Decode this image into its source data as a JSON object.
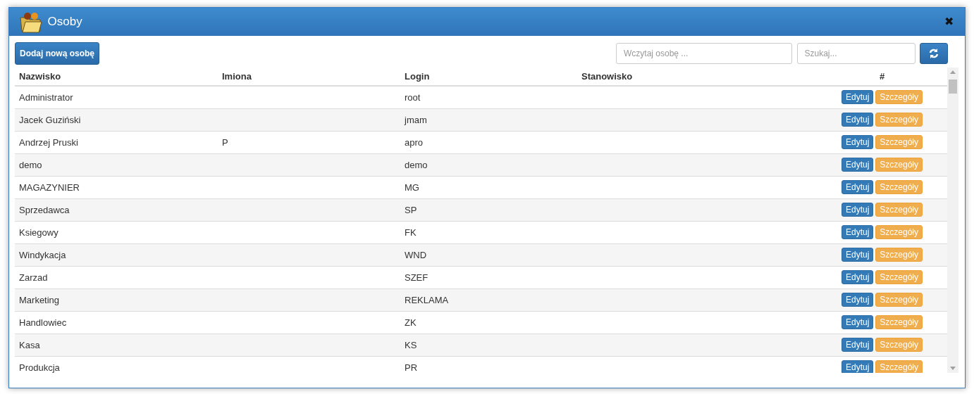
{
  "window": {
    "title": "Osoby",
    "close": "✖"
  },
  "toolbar": {
    "add_button": "Dodaj nową osobę",
    "load_field": {
      "placeholder": "Wczytaj osobę ..."
    },
    "search_field": {
      "placeholder": "Szukaj..."
    }
  },
  "table": {
    "columns": [
      "Nazwisko",
      "Imiona",
      "Login",
      "Stanowisko",
      "#"
    ],
    "rows": [
      {
        "nazwisko": "Administrator",
        "imiona": "",
        "login": "root",
        "stanowisko": "",
        "edit": "Edytuj",
        "details": "Szczegóły"
      },
      {
        "nazwisko": "Jacek Guziński",
        "imiona": "",
        "login": "jmam",
        "stanowisko": "",
        "edit": "Edytuj",
        "details": "Szczegóły"
      },
      {
        "nazwisko": "Andrzej Pruski",
        "imiona": "P",
        "login": "apro",
        "stanowisko": "",
        "edit": "Edytuj",
        "details": "Szczegóły"
      },
      {
        "nazwisko": "demo",
        "imiona": "",
        "login": "demo",
        "stanowisko": "",
        "edit": "Edytuj",
        "details": "Szczegóły"
      },
      {
        "nazwisko": "MAGAZYNIER",
        "imiona": "",
        "login": "MG",
        "stanowisko": "",
        "edit": "Edytuj",
        "details": "Szczegóły"
      },
      {
        "nazwisko": "Sprzedawca",
        "imiona": "",
        "login": "SP",
        "stanowisko": "",
        "edit": "Edytuj",
        "details": "Szczegóły"
      },
      {
        "nazwisko": "Ksiegowy",
        "imiona": "",
        "login": "FK",
        "stanowisko": "",
        "edit": "Edytuj",
        "details": "Szczegóły"
      },
      {
        "nazwisko": "Windykacja",
        "imiona": "",
        "login": "WND",
        "stanowisko": "",
        "edit": "Edytuj",
        "details": "Szczegóły"
      },
      {
        "nazwisko": "Zarzad",
        "imiona": "",
        "login": "SZEF",
        "stanowisko": "",
        "edit": "Edytuj",
        "details": "Szczegóły"
      },
      {
        "nazwisko": "Marketing",
        "imiona": "",
        "login": "REKLAMA",
        "stanowisko": "",
        "edit": "Edytuj",
        "details": "Szczegóły"
      },
      {
        "nazwisko": "Handlowiec",
        "imiona": "",
        "login": "ZK",
        "stanowisko": "",
        "edit": "Edytuj",
        "details": "Szczegóły"
      },
      {
        "nazwisko": "Kasa",
        "imiona": "",
        "login": "KS",
        "stanowisko": "",
        "edit": "Edytuj",
        "details": "Szczegóły"
      },
      {
        "nazwisko": "Produkcja",
        "imiona": "",
        "login": "PR",
        "stanowisko": "",
        "edit": "Edytuj",
        "details": "Szczegóły"
      }
    ]
  }
}
